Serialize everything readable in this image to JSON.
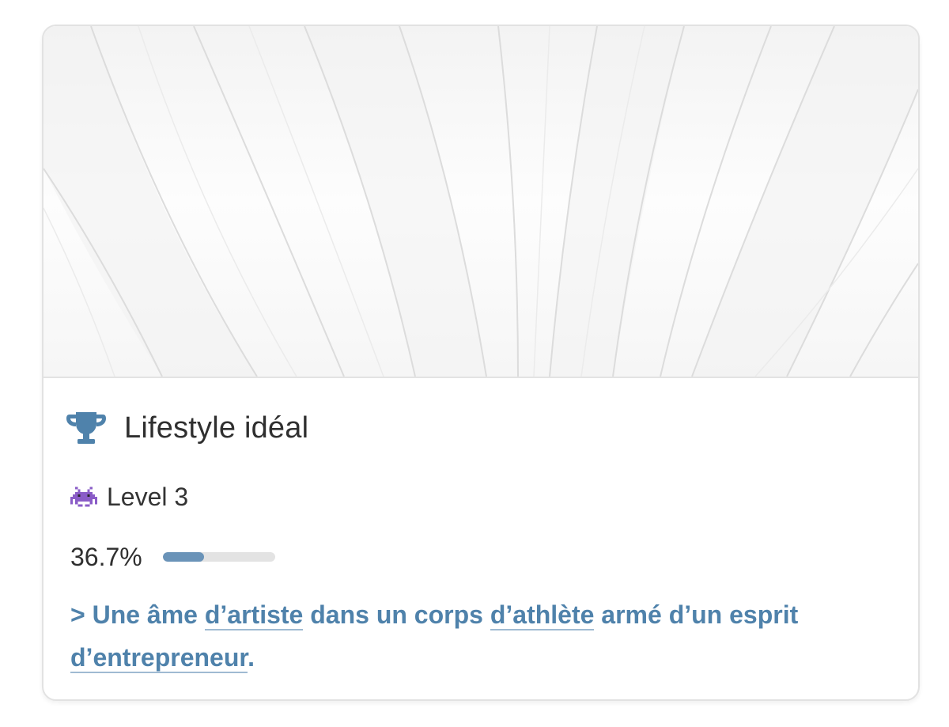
{
  "card": {
    "title": "Lifestyle idéal",
    "icon": "trophy-icon",
    "level_icon": "alien-monster-icon",
    "level_label": "Level 3",
    "progress_text": "36.7%",
    "progress_value": 0.367,
    "quote": {
      "prefix": "> Une âme ",
      "link1": "d’artiste",
      "mid1": " dans un corps ",
      "link2": "d’athlète",
      "mid2": " armé d’un esprit ",
      "link3": "d’entrepreneur",
      "suffix": "."
    }
  },
  "colors": {
    "accent": "#4f82ab",
    "progress_fill": "#6a93b8",
    "progress_track": "#e3e3e3",
    "title": "#2f2f2f",
    "border": "#e2e2e2"
  }
}
